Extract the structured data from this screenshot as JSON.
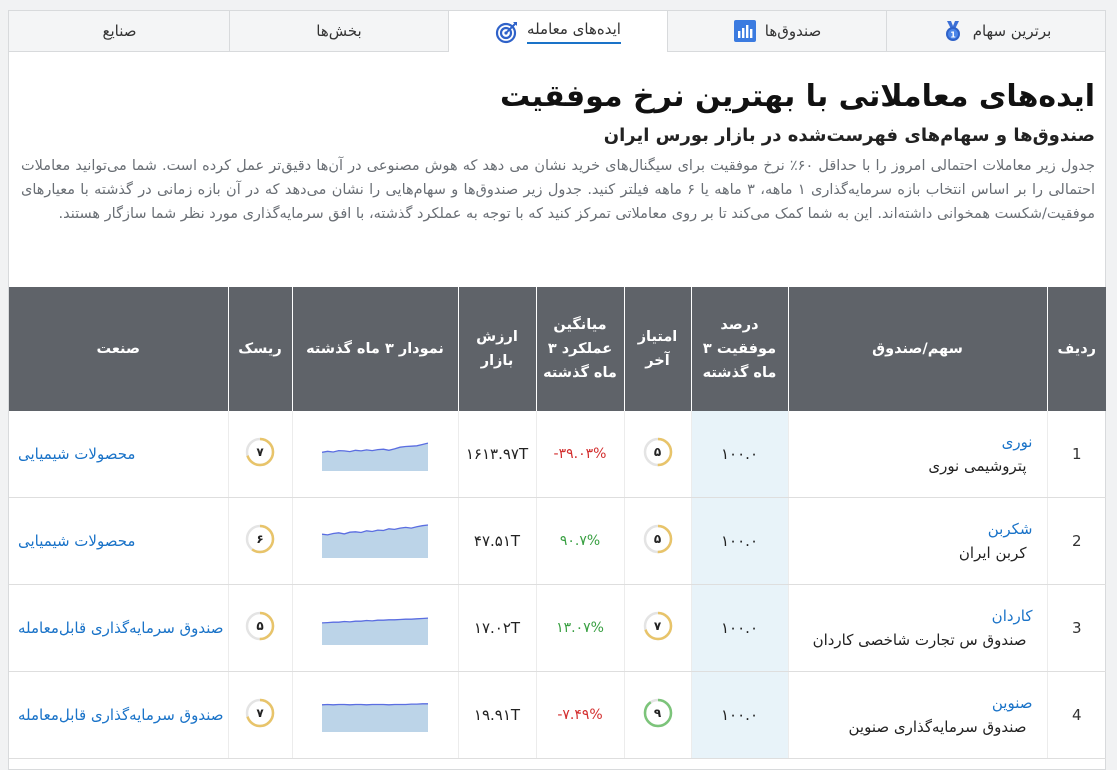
{
  "tabs": [
    {
      "label": "برترین سهام",
      "icon": "medal-icon",
      "active": false
    },
    {
      "label": "صندوق‌ها",
      "icon": "bar-chart-icon",
      "active": false
    },
    {
      "label": "ایده‌های معامله",
      "icon": "target-icon",
      "active": true
    },
    {
      "label": "بخش‌ها",
      "icon": "",
      "active": false
    },
    {
      "label": "صنایع",
      "icon": "",
      "active": false
    }
  ],
  "page": {
    "title": "ایده‌های معاملاتی با بهترین نرخ موفقیت",
    "subtitle": "صندوق‌ها و سهام‌های فهرست‌شده در بازار بورس ایران",
    "description": "جدول زیر معاملات احتمالی امروز را با حداقل ۶۰٪ نرخ موفقیت برای سیگنال‌های خرید نشان می دهد که هوش مصنوعی در آن‌ها دقیق‌تر عمل کرده است. شما می‌توانید معاملات احتمالی را بر اساس انتخاب بازه سرمایه‌گذاری ۱ ماهه، ۳ ماهه یا ۶ ماهه فیلتر کنید. جدول زیر صندوق‌ها و سهام‌هایی را نشان می‌دهد که در آن بازه زمانی در گذشته با معیارهای موفقیت/شکست همخوانی داشته‌اند. این به شما کمک می‌کند تا بر روی معاملاتی تمرکز کنید که با توجه به عملکرد گذشته، با افق سرمایه‌گذاری مورد نظر شما سازگار هستند."
  },
  "table": {
    "headers": {
      "row": "ردیف",
      "stock": "سهم/صندوق",
      "success": "درصد موفقیت ۳ ماه گذشته",
      "score": "امتیاز آخر",
      "avg_perf": "میانگین عملکرد ۳ ماه گذشته",
      "market_value": "ارزش بازار",
      "chart": "نمودار ۳ ماه گذشته",
      "risk": "ریسک",
      "industry": "صنعت"
    },
    "rows": [
      {
        "num": "1",
        "symbol": "نوری",
        "name": "پتروشیمی نوری",
        "success": "۱۰۰.۰",
        "score": "۵",
        "score_frac": 0.5,
        "score_color": "#e8c46a",
        "perf": "-۳۹.۰۳%",
        "perf_sign": "neg",
        "mcap": "۱۶۱۳.۹۷T",
        "spark": [
          0.45,
          0.42,
          0.44,
          0.4,
          0.41,
          0.43,
          0.39,
          0.41,
          0.38,
          0.4,
          0.37,
          0.36,
          0.39,
          0.35,
          0.3,
          0.28,
          0.27,
          0.26,
          0.22,
          0.18
        ],
        "risk": "۷",
        "risk_frac": 0.7,
        "industry": "محصولات شیمیایی"
      },
      {
        "num": "2",
        "symbol": "شکربن",
        "name": "کربن ایران",
        "success": "۱۰۰.۰",
        "score": "۵",
        "score_frac": 0.5,
        "score_color": "#e8c46a",
        "perf": "۹۰.۷%",
        "perf_sign": "pos",
        "mcap": "۴۷.۵۱T",
        "spark": [
          0.3,
          0.32,
          0.28,
          0.26,
          0.29,
          0.24,
          0.23,
          0.25,
          0.2,
          0.22,
          0.18,
          0.19,
          0.14,
          0.16,
          0.12,
          0.1,
          0.12,
          0.08,
          0.05,
          0.03
        ],
        "risk": "۶",
        "risk_frac": 0.6,
        "industry": "محصولات شیمیایی"
      },
      {
        "num": "3",
        "symbol": "کاردان",
        "name": "صندوق س تجارت شاخصی کاردان",
        "success": "۱۰۰.۰",
        "score": "۷",
        "score_frac": 0.7,
        "score_color": "#e8c46a",
        "perf": "۱۳.۰۷%",
        "perf_sign": "pos",
        "mcap": "۱۷.۰۲T",
        "spark": [
          0.35,
          0.34,
          0.33,
          0.33,
          0.31,
          0.32,
          0.3,
          0.3,
          0.28,
          0.29,
          0.27,
          0.27,
          0.26,
          0.26,
          0.25,
          0.24,
          0.24,
          0.23,
          0.22,
          0.21
        ],
        "risk": "۵",
        "risk_frac": 0.5,
        "industry": "صندوق سرمایه‌گذاری قابل‌معامله"
      },
      {
        "num": "4",
        "symbol": "صنوین",
        "name": "صندوق سرمایه‌گذاری صنوین",
        "success": "۱۰۰.۰",
        "score": "۹",
        "score_frac": 0.9,
        "score_color": "#7cc47a",
        "perf": "-۷.۴۹%",
        "perf_sign": "neg",
        "mcap": "۱۹.۹۱T",
        "spark": [
          0.2,
          0.19,
          0.2,
          0.19,
          0.19,
          0.2,
          0.19,
          0.19,
          0.2,
          0.19,
          0.19,
          0.19,
          0.2,
          0.19,
          0.19,
          0.19,
          0.18,
          0.18,
          0.17,
          0.17
        ],
        "risk": "۷",
        "risk_frac": 0.7,
        "industry": "صندوق سرمایه‌گذاری قابل‌معامله"
      }
    ]
  },
  "colors": {
    "accent": "#1a73c8",
    "header_bg": "#5f6369",
    "success_bg": "#e8f3f9",
    "negative": "#d32f2f",
    "positive": "#3aa043",
    "sparkline": "#5b6ee1",
    "sparkfill": "#bcd4e8"
  }
}
